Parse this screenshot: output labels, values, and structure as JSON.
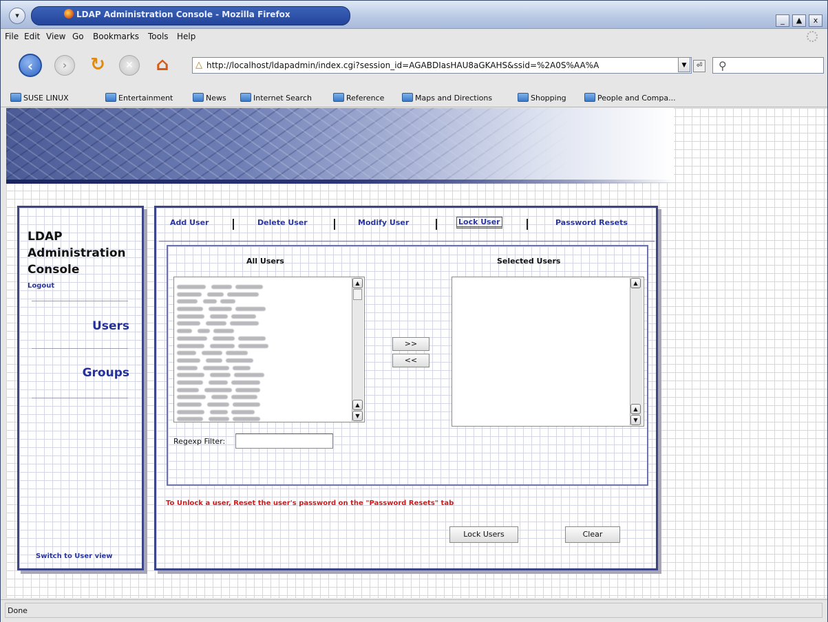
{
  "window": {
    "title": "LDAP Administration Console - Mozilla Firefox",
    "controls": {
      "minimize": "_",
      "maximize": "▲",
      "close": "x"
    }
  },
  "menubar": {
    "items": [
      "File",
      "Edit",
      "View",
      "Go",
      "Bookmarks",
      "Tools",
      "Help"
    ]
  },
  "navbar": {
    "url": "http://localhost/ldapadmin/index.cgi?session_id=AGABDIasHAU8aGKAHS&ssid=%2A0S%AA%A",
    "icons": [
      "back-icon",
      "forward-icon",
      "reload-icon",
      "stop-icon",
      "home-icon",
      "search-icon"
    ]
  },
  "bookmarks": [
    "SUSE LINUX",
    "Entertainment",
    "News",
    "Internet Search",
    "Reference",
    "Maps and Directions",
    "Shopping",
    "People and Compa..."
  ],
  "sidebar": {
    "title_lines": [
      "LDAP",
      "Administration",
      "Console"
    ],
    "logout": "Logout",
    "links": [
      "Users",
      "Groups"
    ],
    "switch_view": "Switch to User view"
  },
  "tabs": [
    "Add User",
    "Delete User",
    "Modify User",
    "Lock User",
    "Password Resets"
  ],
  "active_tab": "Lock User",
  "lists": {
    "all_users_header": "All Users",
    "selected_users_header": "Selected Users",
    "all_users_visible_rows": 19,
    "all_users_content": "blurred user entries",
    "selected_users": []
  },
  "buttons": {
    "add": ">>",
    "remove": "<<",
    "lock": "Lock Users",
    "clear": "Clear"
  },
  "filter": {
    "label": "Regexp Filter:",
    "value": ""
  },
  "notice": "To Unlock a user, Reset the user's password on the \"Password Resets\" tab",
  "status": "Done",
  "colors": {
    "link": "#2a36a0",
    "notice": "#d21a1a",
    "panel_border": "#3c4686"
  }
}
